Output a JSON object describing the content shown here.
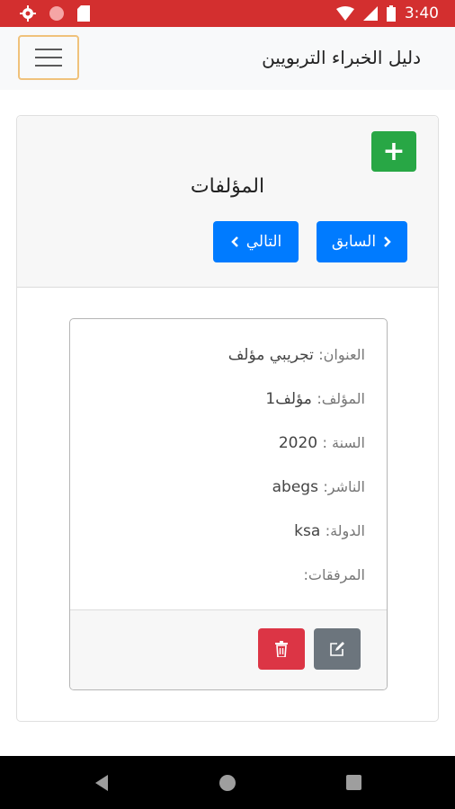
{
  "status_bar": {
    "time": "3:40",
    "icons": [
      "settings-icon",
      "record-icon",
      "sd-card-icon",
      "wifi-icon",
      "signal-icon",
      "battery-icon"
    ]
  },
  "app": {
    "title": "دليل الخبراء التربويين"
  },
  "section": {
    "title": "المؤلفات",
    "add_label": "+",
    "prev_label": "السابق",
    "next_label": "التالي"
  },
  "record": {
    "title_label": "العنوان:",
    "title_value": "تجريبي مؤلف",
    "author_label": "المؤلف:",
    "author_value": "مؤلف1",
    "year_label": "السنة :",
    "year_value": "2020",
    "publisher_label": "الناشر:",
    "publisher_value": "abegs",
    "country_label": "الدولة:",
    "country_value": "ksa",
    "attachments_label": "المرفقات:"
  },
  "colors": {
    "status_bar": "#d32f2f",
    "add_button": "#28a745",
    "nav_button": "#007bff",
    "delete_button": "#dc3545",
    "edit_button": "#6c757d"
  }
}
